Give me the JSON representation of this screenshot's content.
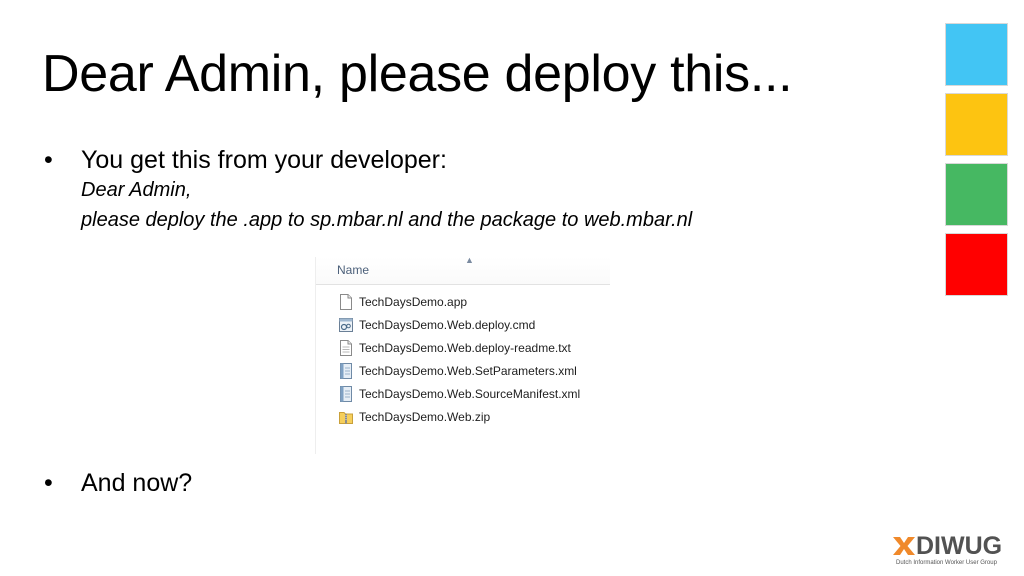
{
  "slide": {
    "title": "Dear Admin, please deploy this...",
    "bullet_symbol": "•",
    "bullets": [
      {
        "text": "You get this from your developer:",
        "lines": [
          "Dear Admin,",
          "please deploy the .app to sp.mbar.nl and the package to web.mbar.nl"
        ]
      },
      {
        "text": "And now?"
      }
    ]
  },
  "explorer": {
    "column_header": "Name",
    "sort_indicator": "▲",
    "files": [
      {
        "name": "TechDaysDemo.app",
        "icon": "document-icon"
      },
      {
        "name": "TechDaysDemo.Web.deploy.cmd",
        "icon": "cmd-script-icon"
      },
      {
        "name": "TechDaysDemo.Web.deploy-readme.txt",
        "icon": "text-file-icon"
      },
      {
        "name": "TechDaysDemo.Web.SetParameters.xml",
        "icon": "xml-file-icon"
      },
      {
        "name": "TechDaysDemo.Web.SourceManifest.xml",
        "icon": "xml-file-icon"
      },
      {
        "name": "TechDaysDemo.Web.zip",
        "icon": "zip-folder-icon"
      }
    ]
  },
  "tiles": {
    "colors": [
      "#42c5f4",
      "#fdc411",
      "#46b862",
      "#ff0000"
    ]
  },
  "logo": {
    "name": "DIWUG",
    "tagline": "Dutch Information Worker User Group",
    "mark_color": "#f0892a"
  }
}
